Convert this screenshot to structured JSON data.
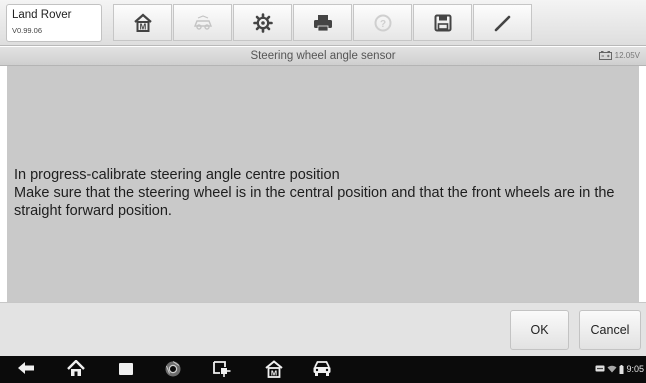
{
  "vehicle": {
    "name": "Land Rover",
    "version": "V0.99.06"
  },
  "toolbar": {
    "buttons": [
      {
        "icon": "home-icon",
        "state": "enabled"
      },
      {
        "icon": "vehicle-swap-icon",
        "state": "disabled"
      },
      {
        "icon": "settings-icon",
        "state": "enabled"
      },
      {
        "icon": "print-icon",
        "state": "enabled"
      },
      {
        "icon": "help-icon",
        "state": "disabled"
      },
      {
        "icon": "save-icon",
        "state": "enabled"
      },
      {
        "icon": "pen-icon",
        "state": "enabled"
      }
    ]
  },
  "title_bar": {
    "title": "Steering wheel angle sensor",
    "battery_voltage": "12.05V"
  },
  "message": {
    "line1": "In progress-calibrate steering angle centre position",
    "line2": "Make sure that the steering wheel is in the central position and that the front wheels are in the straight forward position."
  },
  "buttons": {
    "ok": "OK",
    "cancel": "Cancel"
  },
  "status_bar": {
    "time": "9:05"
  },
  "colors": {
    "content_bg": "#c9c9c9",
    "nav_bar": "#0b0b0b",
    "toolbar": "#e8e8e8"
  }
}
